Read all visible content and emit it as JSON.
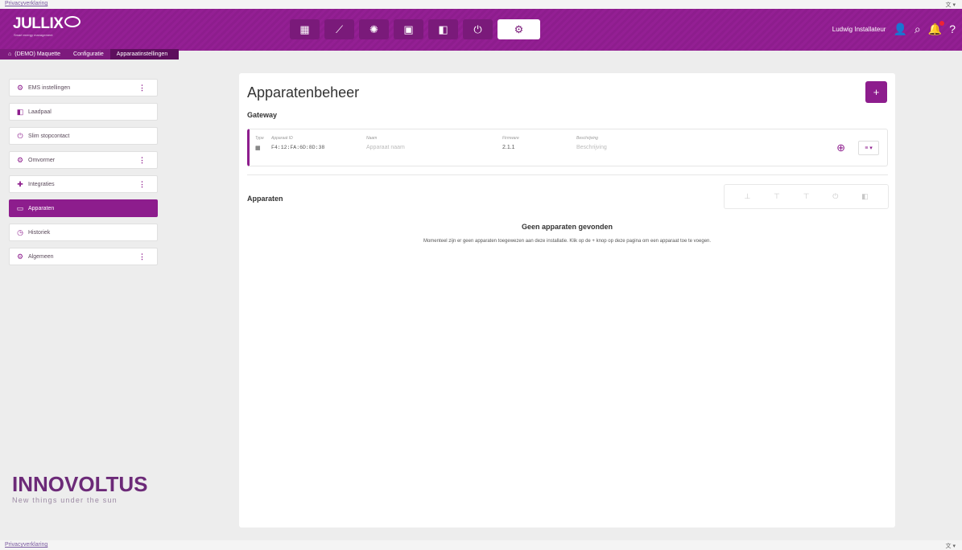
{
  "top_bar": {
    "privacy_link": "Privacyverklaring",
    "language": "文 ▾"
  },
  "header": {
    "logo": "JULLIX",
    "logo_tagline": "Smart energy management",
    "user_name": "Ludwig Installateur",
    "nav": [
      {
        "icon": "dashboard-icon",
        "glyph": "▦"
      },
      {
        "icon": "chart-icon",
        "glyph": "⟋"
      },
      {
        "icon": "brain-icon",
        "glyph": "✺"
      },
      {
        "icon": "battery-icon",
        "glyph": "▣"
      },
      {
        "icon": "device-icon",
        "glyph": "◧"
      },
      {
        "icon": "plug-icon",
        "glyph": "⏻"
      },
      {
        "icon": "gear-icon",
        "glyph": "⚙"
      }
    ],
    "user_icons": {
      "person": "👤",
      "search": "⌕",
      "bell": "🔔",
      "help": "?"
    }
  },
  "breadcrumb": [
    "(DEMO) Maquette",
    "Configuratie",
    "Apparaatinstellingen"
  ],
  "sidebar": {
    "items": [
      {
        "label": "EMS instellingen",
        "icon": "settings-icon",
        "glyph": "⚙",
        "has_menu": true
      },
      {
        "label": "Laadpaal",
        "icon": "charger-icon",
        "glyph": "◧",
        "has_menu": false
      },
      {
        "label": "Slim stopcontact",
        "icon": "plug-icon",
        "glyph": "⏻",
        "has_menu": false
      },
      {
        "label": "Omvormer",
        "icon": "inverter-icon",
        "glyph": "⚙",
        "has_menu": true
      },
      {
        "label": "Integraties",
        "icon": "puzzle-icon",
        "glyph": "✚",
        "has_menu": true
      },
      {
        "label": "Apparaten",
        "icon": "devices-icon",
        "glyph": "▭",
        "has_menu": false,
        "active": true
      },
      {
        "label": "Historiek",
        "icon": "history-icon",
        "glyph": "◷",
        "has_menu": false
      },
      {
        "label": "Algemeen",
        "icon": "gear-icon",
        "glyph": "⚙",
        "has_menu": true
      }
    ],
    "menu_glyph": "⋮"
  },
  "brand": {
    "name": "INNOVOLTUS",
    "tagline": "New things under the sun"
  },
  "main": {
    "title": "Apparatenbeheer",
    "add_label": "+",
    "gateway_title": "Gateway",
    "gateway": {
      "type_label": "Type",
      "type_glyph": "▦",
      "id_label": "Apparaat ID",
      "id_value": "F4:12:FA:6D:8D:38",
      "name_label": "Naam",
      "name_placeholder": "Apparaat naam",
      "firmware_label": "Firmware",
      "firmware_value": "2.1.1",
      "desc_label": "Beschrijving",
      "desc_placeholder": "Beschrijving",
      "menu_label": "≡ ▾",
      "network_glyph": "⊕"
    },
    "devices_title": "Apparaten",
    "device_filters": [
      "⊥",
      "⊤",
      "⊤",
      "⏻",
      "◧"
    ],
    "empty_title": "Geen apparaten gevonden",
    "empty_text": "Momenteel zijn er geen apparaten toegewezen aan deze installatie. Klik op de + knop op deze pagina om een apparaat toe te voegen."
  },
  "footer": {
    "privacy_link": "Privacyverklaring",
    "language": "文 ▾"
  }
}
